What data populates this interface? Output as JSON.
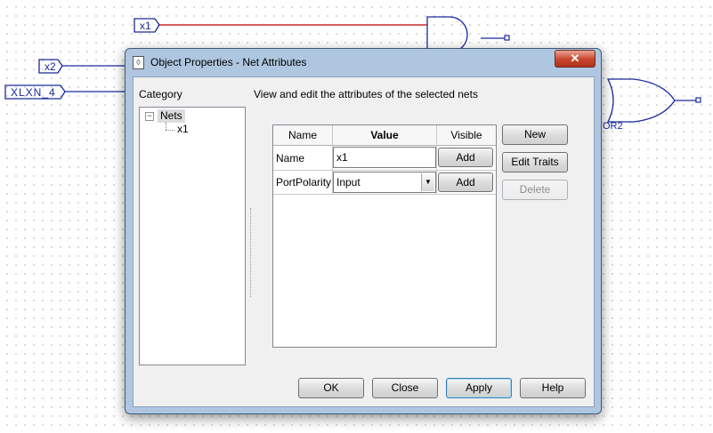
{
  "schematic": {
    "ports": [
      "x1",
      "x2",
      "XLXN_4"
    ],
    "gate_label": "OR2"
  },
  "dialog": {
    "title": "Object Properties - Net Attributes",
    "close_symbol": "✕",
    "category_label": "Category",
    "description": "View and edit the attributes of the selected nets",
    "tree": {
      "expander": "−",
      "root": "Nets",
      "child": "x1"
    },
    "grid": {
      "headers": {
        "name": "Name",
        "value": "Value",
        "visible": "Visible"
      },
      "rows": [
        {
          "name": "Name",
          "value": "x1",
          "button": "Add"
        },
        {
          "name": "PortPolarity",
          "value": "Input",
          "button": "Add"
        }
      ],
      "combo_arrow": "▼"
    },
    "side_buttons": {
      "new": "New",
      "edit_traits": "Edit Traits",
      "delete": "Delete"
    },
    "footer_buttons": {
      "ok": "OK",
      "close": "Close",
      "apply": "Apply",
      "help": "Help"
    }
  }
}
